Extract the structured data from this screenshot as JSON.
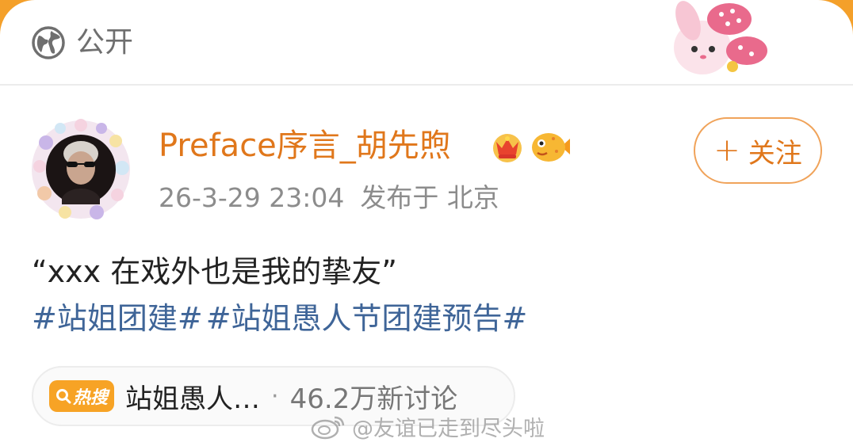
{
  "visibility": {
    "icon": "globe-icon",
    "label": "公开"
  },
  "author": {
    "name": "Preface序言_胡先煦",
    "badges": [
      "crown-badge-icon",
      "pufferfish-badge-icon"
    ],
    "avatar": "avatar"
  },
  "follow_button": {
    "icon": "plus-icon",
    "plus": "+",
    "label": "关注"
  },
  "meta": {
    "time": "26-3-29 23:04",
    "location": "发布于 北京"
  },
  "post": {
    "text": "“xxx 在戏外也是我的挚友”",
    "topics": [
      "#站姐团建#",
      "#站姐愚人节团建预告#"
    ]
  },
  "hot_search": {
    "tag_label": "热搜",
    "tag_icon": "search-icon",
    "title": "站姐愚人…",
    "dot": "·",
    "count": "46.2万新讨论"
  },
  "watermark": {
    "text": "@友谊已走到尽头啦",
    "icon": "weibo-logo-icon"
  },
  "colors": {
    "accent": "#e0771b",
    "topic": "#3f6598",
    "hot_tag": "#f7a325",
    "frame": "#f4a02a"
  }
}
